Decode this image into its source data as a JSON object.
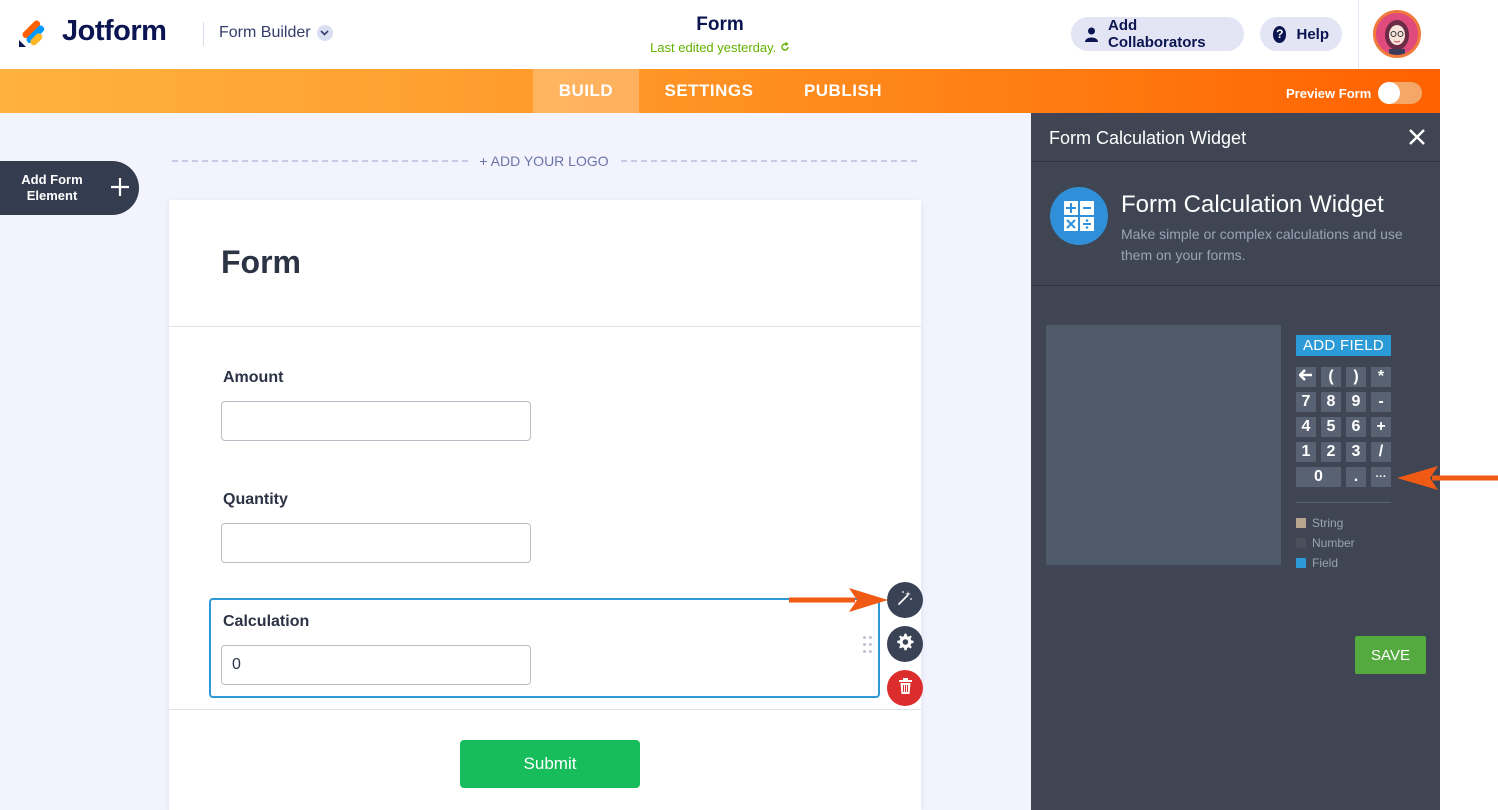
{
  "header": {
    "brand": "Jotform",
    "builder_menu": "Form Builder",
    "form_title": "Form",
    "last_edited": "Last edited yesterday.",
    "add_collaborators": "Add Collaborators",
    "help": "Help"
  },
  "nav": {
    "tabs": [
      {
        "label": "BUILD",
        "active": true
      },
      {
        "label": "SETTINGS",
        "active": false
      },
      {
        "label": "PUBLISH",
        "active": false
      }
    ],
    "preview_label": "Preview Form",
    "preview_on": false
  },
  "canvas": {
    "add_element_label": "Add Form Element",
    "add_logo": "+ ADD YOUR LOGO",
    "form_heading": "Form",
    "fields": [
      {
        "label": "Amount",
        "value": ""
      },
      {
        "label": "Quantity",
        "value": ""
      },
      {
        "label": "Calculation",
        "value": "0"
      }
    ],
    "submit_label": "Submit"
  },
  "panel": {
    "header_title": "Form Calculation Widget",
    "widget_title": "Form Calculation Widget",
    "widget_description": "Make simple or complex calculations and use them on your forms.",
    "add_field": "ADD FIELD",
    "keypad": [
      [
        "←",
        "(",
        ")",
        "*"
      ],
      [
        "7",
        "8",
        "9",
        "-"
      ],
      [
        "4",
        "5",
        "6",
        "+"
      ],
      [
        "1",
        "2",
        "3",
        "/"
      ],
      [
        "0",
        ".",
        "···"
      ]
    ],
    "legend": [
      {
        "label": "String",
        "color": "#b8a590"
      },
      {
        "label": "Number",
        "color": "#4a505c"
      },
      {
        "label": "Field",
        "color": "#2b9ad6"
      }
    ],
    "save_label": "SAVE"
  },
  "colors": {
    "accent_orange": "#ff6100",
    "calc_highlight": "#2b9ad6",
    "submit_green": "#18bd5b",
    "save_green": "#54a93f",
    "delete_red": "#dc2c2c",
    "panel_bg": "#3f4552"
  },
  "icons": [
    "jotform-logo-icon",
    "chevron-down-icon",
    "user-icon",
    "help-icon",
    "refresh-icon",
    "plus-icon",
    "magic-wand-icon",
    "gear-icon",
    "trash-icon",
    "close-icon",
    "calculator-icon",
    "drag-handle-icon",
    "arrow-annotation-icon"
  ]
}
